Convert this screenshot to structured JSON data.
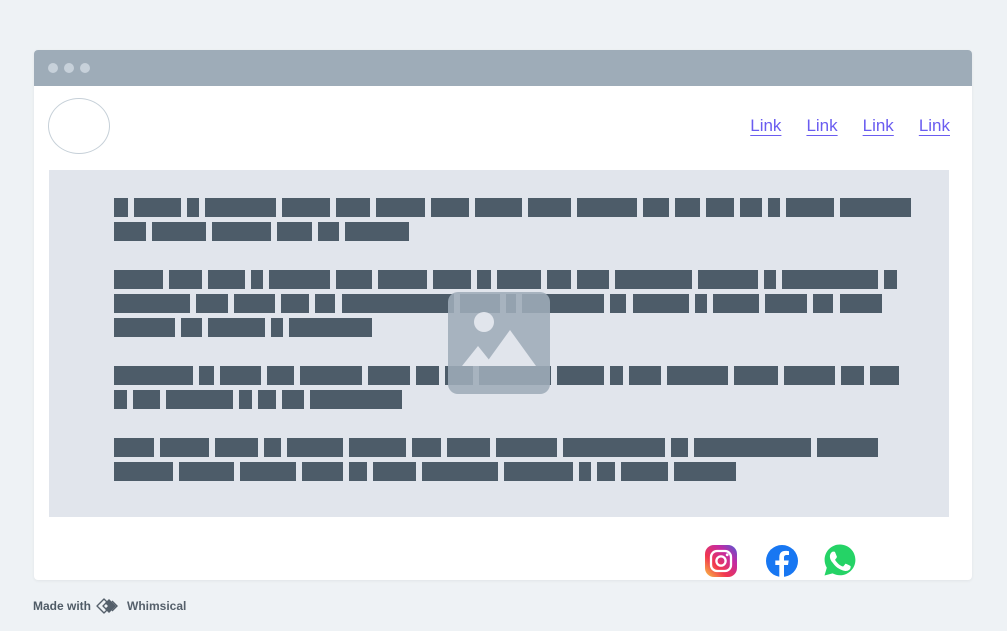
{
  "nav": {
    "links": [
      "Link",
      "Link",
      "Link",
      "Link"
    ]
  },
  "icons": {
    "logo": "circle-logo-placeholder",
    "image": "image-placeholder-icon",
    "social": [
      "instagram-icon",
      "facebook-icon",
      "whatsapp-icon"
    ]
  },
  "colors": {
    "page_bg": "#eef2f5",
    "titlebar": "#9eacb8",
    "content_bg": "#e1e5ec",
    "text_block": "#4d5c69",
    "link": "#6a5cf0"
  },
  "footer": {
    "made_with": "Made with",
    "brand": "Whimsical"
  }
}
